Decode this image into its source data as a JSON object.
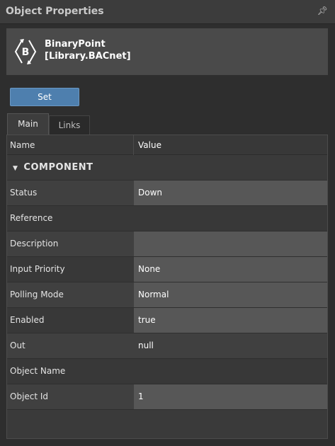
{
  "panel": {
    "title": "Object Properties",
    "pin_icon": "pin-icon"
  },
  "object": {
    "name_line1": "BinaryPoint",
    "name_line2": "[Library.BACnet]",
    "icon_letter": "B"
  },
  "toolbar": {
    "set_label": "Set"
  },
  "tabs": [
    {
      "label": "Main",
      "active": true
    },
    {
      "label": "Links",
      "active": false
    }
  ],
  "grid": {
    "headers": {
      "name": "Name",
      "value": "Value"
    },
    "section": "COMPONENT",
    "rows": [
      {
        "name": "Status",
        "value": "Down"
      },
      {
        "name": "Reference",
        "value": ""
      },
      {
        "name": "Description",
        "value": ""
      },
      {
        "name": "Input Priority",
        "value": "None"
      },
      {
        "name": "Polling Mode",
        "value": "Normal"
      },
      {
        "name": "Enabled",
        "value": "true"
      },
      {
        "name": "Out",
        "value": "null"
      },
      {
        "name": "Object Name",
        "value": ""
      },
      {
        "name": "Object Id",
        "value": "1"
      }
    ]
  },
  "colors": {
    "accent": "#4e7fae",
    "background": "#2e2e2e",
    "value_cell": "#575757"
  }
}
